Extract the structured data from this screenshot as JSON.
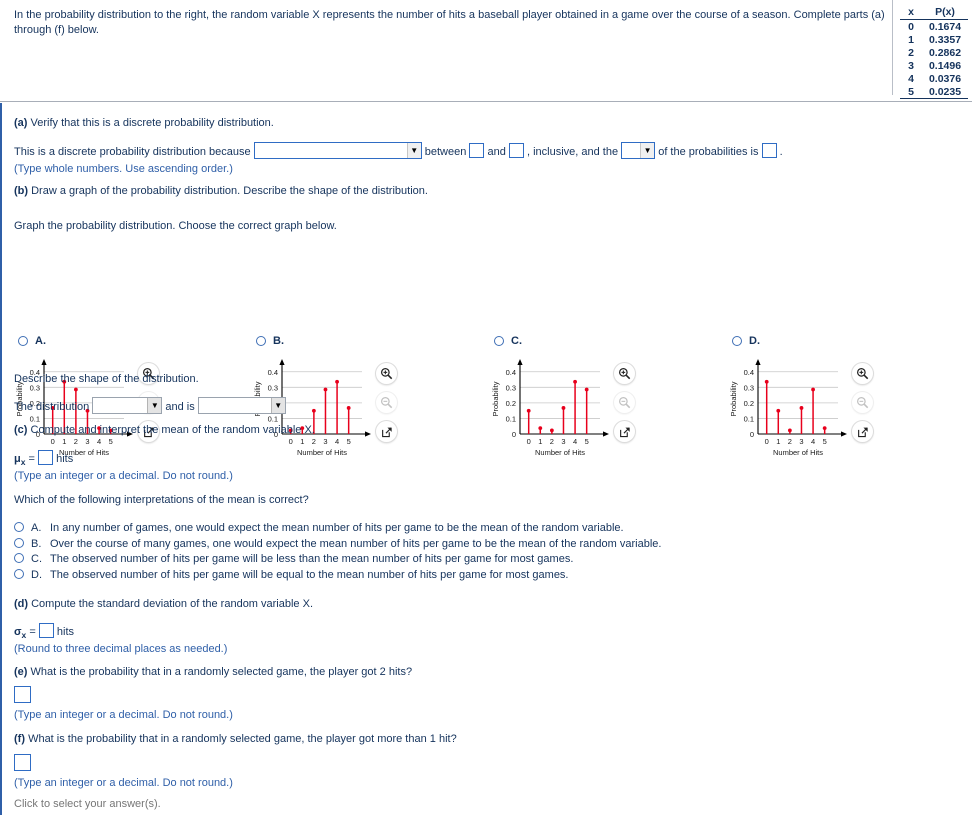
{
  "question": {
    "stem": "In the probability distribution to the right, the random variable X represents the number of hits a baseball player obtained in a game over the course of a season. Complete parts (a) through (f) below."
  },
  "dist_table": {
    "headers": [
      "x",
      "P(x)"
    ],
    "rows": [
      [
        "0",
        "0.1674"
      ],
      [
        "1",
        "0.3357"
      ],
      [
        "2",
        "0.2862"
      ],
      [
        "3",
        "0.1496"
      ],
      [
        "4",
        "0.0376"
      ],
      [
        "5",
        "0.0235"
      ]
    ]
  },
  "part_a": {
    "prompt": "(a) Verify that this is a discrete probability distribution.",
    "sentence_1": "This is a discrete probability distribution because",
    "dropdown_1_value": "",
    "sentence_2": "between",
    "box_1_value": "",
    "sentence_3": "and",
    "box_2_value": "",
    "sentence_4": ", inclusive, and the",
    "dropdown_2_value": "",
    "sentence_5": "of the probabilities is",
    "box_3_value": "",
    "sentence_6": ".",
    "note": "(Type whole numbers. Use ascending order.)"
  },
  "part_b": {
    "prompt": "(b) Draw a graph of the probability distribution. Describe the shape of the distribution.",
    "instruction": "Graph the probability distribution. Choose the correct graph below.",
    "describe_prompt": "Describe the shape of the distribution.",
    "shape_sentence_1": "The distribution",
    "shape_dropdown_1_value": "",
    "shape_sentence_2": "and is",
    "shape_dropdown_2_value": "",
    "options": [
      {
        "letter": "A.",
        "values": [
          0.1674,
          0.3357,
          0.2862,
          0.1496,
          0.0376,
          0.0235
        ]
      },
      {
        "letter": "B.",
        "values": [
          0.0235,
          0.0376,
          0.1496,
          0.2862,
          0.3357,
          0.1674
        ]
      },
      {
        "letter": "C.",
        "values": [
          0.1496,
          0.0376,
          0.0235,
          0.1674,
          0.3357,
          0.2862
        ]
      },
      {
        "letter": "D.",
        "values": [
          0.3357,
          0.1496,
          0.0235,
          0.1674,
          0.2862,
          0.0376
        ]
      }
    ],
    "axis": {
      "xlabel": "Number of Hits",
      "ylabel": "Probability",
      "xticks": [
        "0",
        "1",
        "2",
        "3",
        "4",
        "5"
      ],
      "yticks": [
        "0",
        "0.1",
        "0.2",
        "0.3",
        "0.4"
      ],
      "ylim": [
        0,
        0.45
      ]
    },
    "icons": {
      "zoom_in": "zoom-in-icon",
      "zoom_out": "zoom-out-icon",
      "popout": "popout-icon"
    }
  },
  "part_c": {
    "prompt": "(c) Compute and interpret the mean of the random variable X.",
    "mu_symbol": "μ",
    "mu_subscript": "x",
    "equals": "=",
    "unit": "hits",
    "mu_value": "",
    "note": "(Type an integer or a decimal. Do not round.)",
    "mc_prompt": "Which of the following interpretations of the mean is correct?",
    "choices": [
      {
        "letter": "A.",
        "text": "In any number of games, one would expect the mean number of hits per game to be the mean of the random variable."
      },
      {
        "letter": "B.",
        "text": "Over the course of many games, one would expect the mean number of hits per game to be the mean of the random variable."
      },
      {
        "letter": "C.",
        "text": "The observed number of hits per game will be less than the mean number of hits per game for most games."
      },
      {
        "letter": "D.",
        "text": "The observed number of hits per game will be equal to the mean number of hits per game for most games."
      }
    ]
  },
  "part_d": {
    "prompt": "(d) Compute the standard deviation of the random variable X.",
    "sigma_symbol": "σ",
    "sigma_subscript": "x",
    "equals": "=",
    "unit": "hits",
    "sigma_value": "",
    "note": "(Round to three decimal places as needed.)"
  },
  "part_e": {
    "prompt": "(e) What is the probability that in a randomly selected game, the player got 2 hits?",
    "answer_value": "",
    "note": "(Type an integer or a decimal. Do not round.)"
  },
  "part_f": {
    "prompt": "(f) What is the probability that in a randomly selected game, the player got more than 1 hit?",
    "answer_value": "",
    "note": "(Type an integer or a decimal. Do not round.)"
  },
  "footer": {
    "hint": "Click to select your answer(s)."
  },
  "chart_data": [
    {
      "type": "scatter",
      "title": "A.",
      "categories": [
        "0",
        "1",
        "2",
        "3",
        "4",
        "5"
      ],
      "values": [
        0.1674,
        0.3357,
        0.2862,
        0.1496,
        0.0376,
        0.0235
      ],
      "xlabel": "Number of Hits",
      "ylabel": "Probability",
      "ylim": [
        0,
        0.45
      ],
      "yticks": [
        0,
        0.1,
        0.2,
        0.3,
        0.4
      ],
      "grid": true,
      "legend": "none"
    },
    {
      "type": "scatter",
      "title": "B.",
      "categories": [
        "0",
        "1",
        "2",
        "3",
        "4",
        "5"
      ],
      "values": [
        0.0235,
        0.0376,
        0.1496,
        0.2862,
        0.3357,
        0.1674
      ],
      "xlabel": "Number of Hits",
      "ylabel": "Probability",
      "ylim": [
        0,
        0.45
      ],
      "yticks": [
        0,
        0.1,
        0.2,
        0.3,
        0.4
      ],
      "grid": true,
      "legend": "none"
    },
    {
      "type": "scatter",
      "title": "C.",
      "categories": [
        "0",
        "1",
        "2",
        "3",
        "4",
        "5"
      ],
      "values": [
        0.1496,
        0.0376,
        0.0235,
        0.1674,
        0.3357,
        0.2862
      ],
      "xlabel": "Number of Hits",
      "ylabel": "Probability",
      "ylim": [
        0,
        0.45
      ],
      "yticks": [
        0,
        0.1,
        0.2,
        0.3,
        0.4
      ],
      "grid": true,
      "legend": "none"
    },
    {
      "type": "scatter",
      "title": "D.",
      "categories": [
        "0",
        "1",
        "2",
        "3",
        "4",
        "5"
      ],
      "values": [
        0.3357,
        0.1496,
        0.0235,
        0.1674,
        0.2862,
        0.0376
      ],
      "xlabel": "Number of Hits",
      "ylabel": "Probability",
      "ylim": [
        0,
        0.45
      ],
      "yticks": [
        0,
        0.1,
        0.2,
        0.3,
        0.4
      ],
      "grid": true,
      "legend": "none"
    }
  ]
}
